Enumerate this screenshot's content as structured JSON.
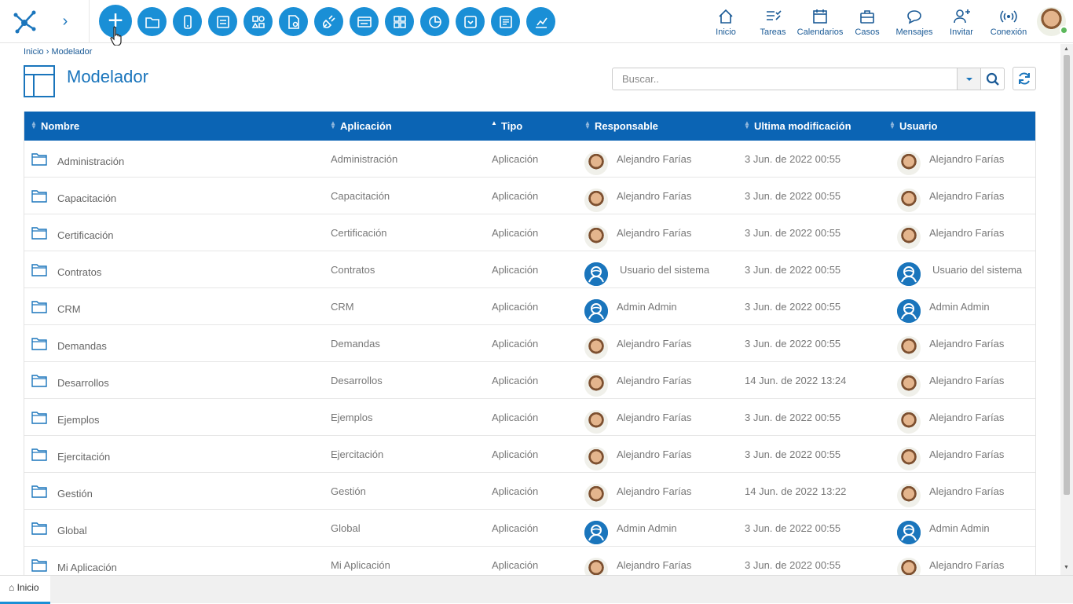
{
  "colors": {
    "accent": "#1a8fd6",
    "header_bg": "#0b64b4",
    "title": "#1a75bc",
    "online": "#5cb85c"
  },
  "toolbar": {
    "add_icon": "plus-icon",
    "icons": [
      "folder-icon",
      "mobile-icon",
      "form-icon",
      "shapes-icon",
      "document-gear-icon",
      "plug-icon",
      "window-icon",
      "dashboard-icon",
      "pie-chart-icon",
      "dropdown-icon",
      "report-icon",
      "chart-edit-icon"
    ]
  },
  "nav": {
    "inicio": "Inicio",
    "tareas": "Tareas",
    "calendarios": "Calendarios",
    "casos": "Casos",
    "mensajes": "Mensajes",
    "invitar": "Invitar",
    "conexion": "Conexión"
  },
  "breadcrumb": {
    "home": "Inicio",
    "sep": " › ",
    "current": "Modelador"
  },
  "page": {
    "title": "Modelador"
  },
  "search": {
    "placeholder": "Buscar.."
  },
  "table": {
    "columns": {
      "nombre": "Nombre",
      "aplicacion": "Aplicación",
      "tipo": "Tipo",
      "responsable": "Responsable",
      "ultima": "Ultima modificación",
      "usuario": "Usuario"
    },
    "rows": [
      {
        "nombre": "Administración",
        "aplicacion": "Administración",
        "tipo": "Aplicación",
        "responsable": "Alejandro Farías",
        "fecha": "3 Jun. de 2022 00:55",
        "usuario": "Alejandro Farías",
        "avatar": "photo"
      },
      {
        "nombre": "Capacitación",
        "aplicacion": "Capacitación",
        "tipo": "Aplicación",
        "responsable": "Alejandro Farías",
        "fecha": "3 Jun. de 2022 00:55",
        "usuario": "Alejandro Farías",
        "avatar": "photo"
      },
      {
        "nombre": "Certificación",
        "aplicacion": "Certificación",
        "tipo": "Aplicación",
        "responsable": "Alejandro Farías",
        "fecha": "3 Jun. de 2022 00:55",
        "usuario": "Alejandro Farías",
        "avatar": "photo"
      },
      {
        "nombre": "Contratos",
        "aplicacion": "Contratos",
        "tipo": "Aplicación",
        "responsable": "Usuario del sistema",
        "fecha": "3 Jun. de 2022 00:55",
        "usuario": "Usuario del sistema",
        "avatar": "system"
      },
      {
        "nombre": "CRM",
        "aplicacion": "CRM",
        "tipo": "Aplicación",
        "responsable": "Admin Admin",
        "fecha": "3 Jun. de 2022 00:55",
        "usuario": "Admin Admin",
        "avatar": "system"
      },
      {
        "nombre": "Demandas",
        "aplicacion": "Demandas",
        "tipo": "Aplicación",
        "responsable": "Alejandro Farías",
        "fecha": "3 Jun. de 2022 00:55",
        "usuario": "Alejandro Farías",
        "avatar": "photo"
      },
      {
        "nombre": "Desarrollos",
        "aplicacion": "Desarrollos",
        "tipo": "Aplicación",
        "responsable": "Alejandro Farías",
        "fecha": "14 Jun. de 2022 13:24",
        "usuario": "Alejandro Farías",
        "avatar": "photo"
      },
      {
        "nombre": "Ejemplos",
        "aplicacion": "Ejemplos",
        "tipo": "Aplicación",
        "responsable": "Alejandro Farías",
        "fecha": "3 Jun. de 2022 00:55",
        "usuario": "Alejandro Farías",
        "avatar": "photo"
      },
      {
        "nombre": "Ejercitación",
        "aplicacion": "Ejercitación",
        "tipo": "Aplicación",
        "responsable": "Alejandro Farías",
        "fecha": "3 Jun. de 2022 00:55",
        "usuario": "Alejandro Farías",
        "avatar": "photo"
      },
      {
        "nombre": "Gestión",
        "aplicacion": "Gestión",
        "tipo": "Aplicación",
        "responsable": "Alejandro Farías",
        "fecha": "14 Jun. de 2022 13:22",
        "usuario": "Alejandro Farías",
        "avatar": "photo"
      },
      {
        "nombre": "Global",
        "aplicacion": "Global",
        "tipo": "Aplicación",
        "responsable": "Admin Admin",
        "fecha": "3 Jun. de 2022 00:55",
        "usuario": "Admin Admin",
        "avatar": "system"
      },
      {
        "nombre": "Mi Aplicación",
        "aplicacion": "Mi Aplicación",
        "tipo": "Aplicación",
        "responsable": "Alejandro Farías",
        "fecha": "3 Jun. de 2022 00:55",
        "usuario": "Alejandro Farías",
        "avatar": "photo"
      }
    ]
  },
  "bottom_tab": {
    "label": "Inicio"
  }
}
